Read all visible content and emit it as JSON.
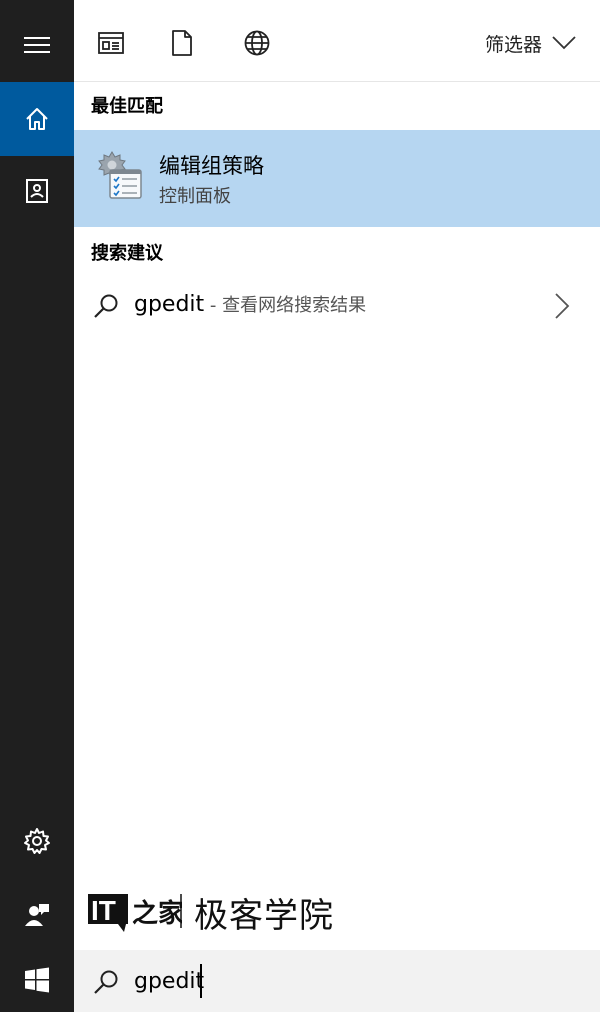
{
  "rail": {
    "items": [
      {
        "icon": "hamburger-menu-icon"
      },
      {
        "icon": "home-icon",
        "active": true
      },
      {
        "icon": "notebook-icon"
      },
      {
        "icon": "gear-icon"
      },
      {
        "icon": "feedback-person-icon"
      },
      {
        "icon": "windows-logo-icon"
      }
    ],
    "active_color": "#005a9e",
    "background": "#1f1f1f"
  },
  "topbar": {
    "filter_label": "筛选器",
    "icons": [
      "apps-icon",
      "document-icon",
      "web-globe-icon",
      "chevron-down-icon"
    ]
  },
  "best_match": {
    "heading": "最佳匹配",
    "title": "编辑组策略",
    "subtitle": "控制面板",
    "highlight_color": "#b6d6f1",
    "icon": "group-policy-app-icon"
  },
  "suggestions": {
    "heading": "搜索建议",
    "items": [
      {
        "query": "gpedit",
        "suffix": " - 查看网络搜索结果",
        "icon": "search-icon"
      }
    ]
  },
  "watermark": {
    "logo": "IT之家",
    "text": "极客学院"
  },
  "search": {
    "value": "gpedit"
  }
}
